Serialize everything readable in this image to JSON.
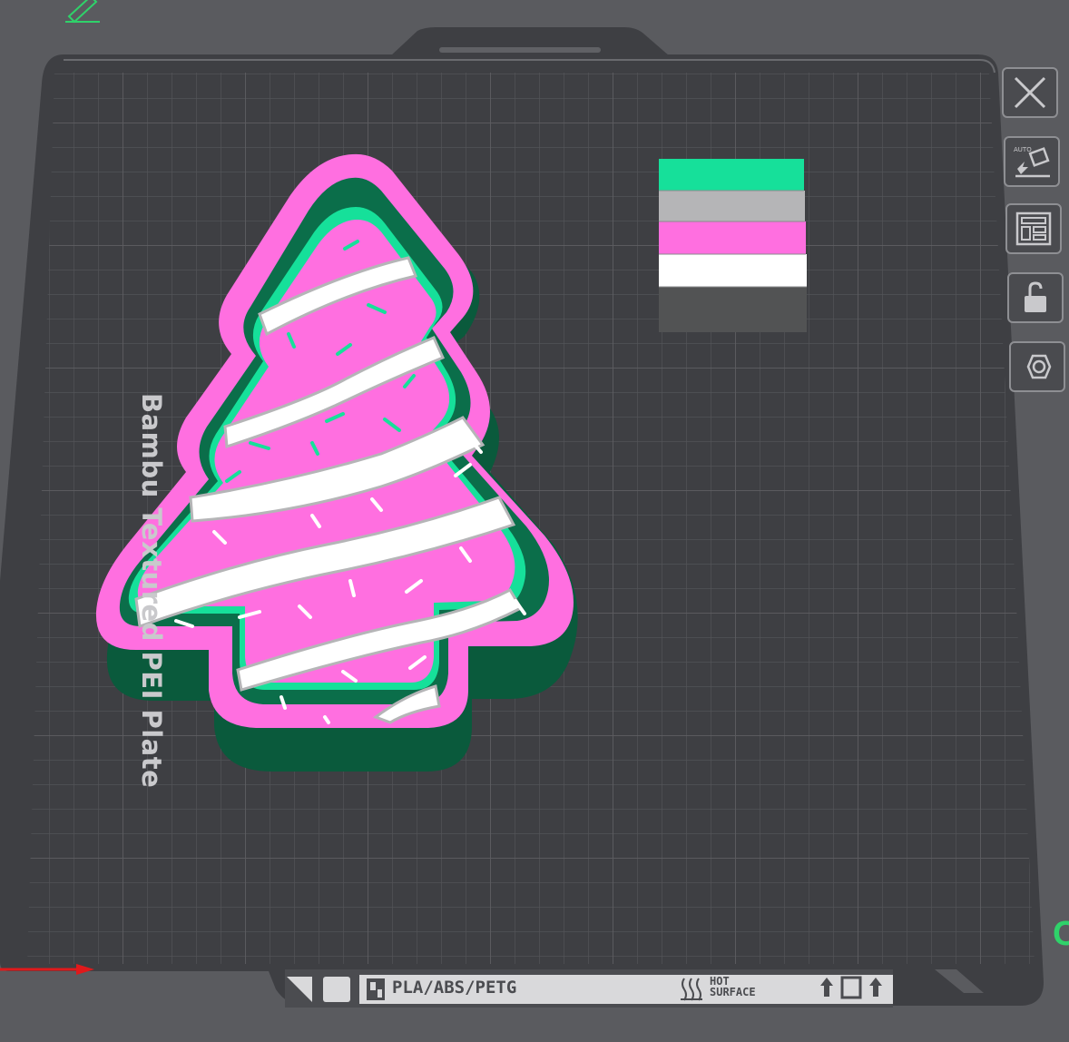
{
  "plate": {
    "name": "Bambu Textured PEI Plate"
  },
  "plate_strip": {
    "materials": "PLA/ABS/PETG",
    "hot_label_line1": "HOT",
    "hot_label_line2": "SURFACE"
  },
  "toolbar": {
    "items": [
      {
        "name": "close",
        "icon": "close-icon"
      },
      {
        "name": "auto-orient",
        "icon": "auto-orient-icon",
        "label": "AUTO"
      },
      {
        "name": "arrange",
        "icon": "arrange-icon"
      },
      {
        "name": "lock",
        "icon": "lock-icon"
      },
      {
        "name": "settings",
        "icon": "hexagon-icon"
      }
    ]
  },
  "axis": {
    "y_label": "C"
  },
  "colors": {
    "background": "#5a5b5f",
    "plate": "#3e3f43",
    "grid": "#55565a",
    "tree_pink": "#ff6fe0",
    "tree_green": "#0a5a3c",
    "tree_mint": "#16e09a",
    "white": "#ffffff",
    "gray": "#b5b5b7",
    "dark_gray": "#525354"
  },
  "color_swatch": {
    "stripes": [
      "#16e09a",
      "#b5b5b7",
      "#ff6fe0",
      "#ffffff",
      "#525354"
    ]
  }
}
